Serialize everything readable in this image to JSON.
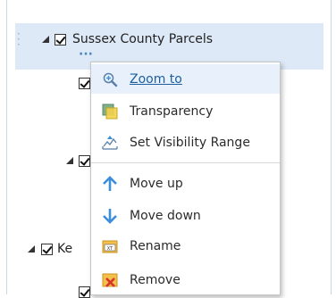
{
  "layers": {
    "top_label": "Sussex County Parcels",
    "partial_label": "Ke"
  },
  "context_menu": {
    "items": [
      {
        "label": "Zoom to",
        "icon": "zoom-to-icon"
      },
      {
        "label": "Transparency",
        "icon": "transparency-icon"
      },
      {
        "label": "Set Visibility Range",
        "icon": "visibility-range-icon"
      },
      {
        "label": "Move up",
        "icon": "arrow-up-icon"
      },
      {
        "label": "Move down",
        "icon": "arrow-down-icon"
      },
      {
        "label": "Rename",
        "icon": "rename-icon"
      },
      {
        "label": "Remove",
        "icon": "remove-icon"
      }
    ]
  },
  "colors": {
    "selected_row": "#dde9f6",
    "link_text": "#1d5fa0",
    "arrow_blue": "#3b8fd9",
    "menu_hover": "#e8f1fb"
  }
}
